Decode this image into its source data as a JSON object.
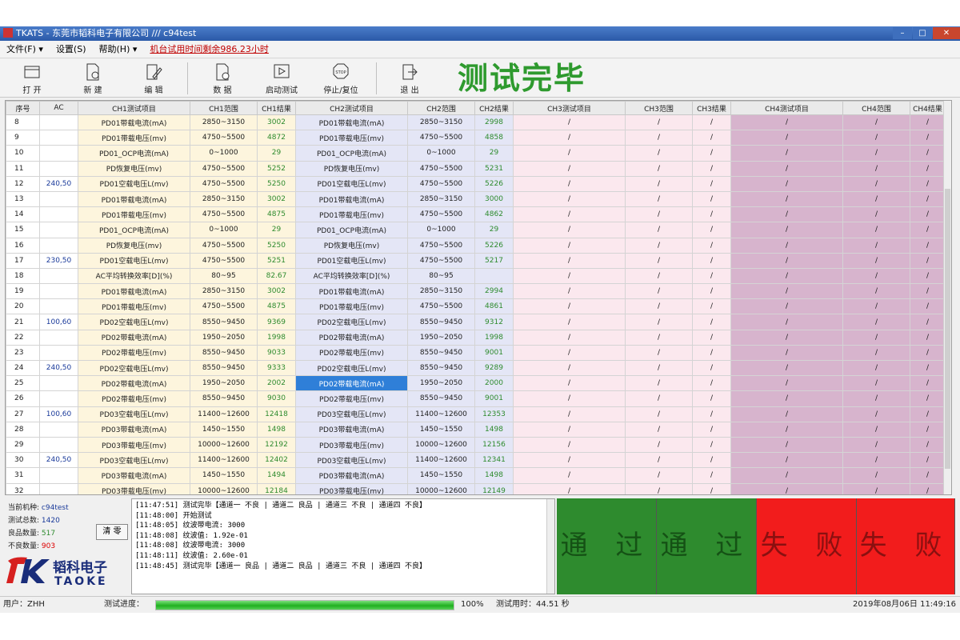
{
  "window": {
    "title": "TKATS - 东莞市韬科电子有限公司 /// c94test",
    "controls": [
      "–",
      "□",
      "✕"
    ]
  },
  "menu": {
    "items": [
      "文件(F) ▾",
      "设置(S)",
      "帮助(H) ▾"
    ],
    "trial_notice": "机台试用时间剩余986.23小时"
  },
  "toolbar": {
    "open": "打 开",
    "new": "新 建",
    "edit": "编 辑",
    "data": "数 据",
    "start": "启动测试",
    "stop": "停止/复位",
    "exit": "退 出",
    "status": "测试完毕"
  },
  "grid": {
    "headers": [
      "序号",
      "AC",
      "CH1测试项目",
      "CH1范围",
      "CH1结果",
      "CH2测试项目",
      "CH2范围",
      "CH2结果",
      "CH3测试项目",
      "CH3范围",
      "CH3结果",
      "CH4测试项目",
      "CH4范围",
      "CH4结果"
    ],
    "rows": [
      [
        "8",
        "",
        "PD01带载电流(mA)",
        "2850~3150",
        "3002",
        "PD01带载电流(mA)",
        "2850~3150",
        "2998"
      ],
      [
        "9",
        "",
        "PD01带载电压(mv)",
        "4750~5500",
        "4872",
        "PD01带载电压(mv)",
        "4750~5500",
        "4858"
      ],
      [
        "10",
        "",
        "PD01_OCP电流(mA)",
        "0~1000",
        "29",
        "PD01_OCP电流(mA)",
        "0~1000",
        "29"
      ],
      [
        "11",
        "",
        "PD恢复电压(mv)",
        "4750~5500",
        "5252",
        "PD恢复电压(mv)",
        "4750~5500",
        "5231"
      ],
      [
        "12",
        "240,50",
        "PD01空载电压L(mv)",
        "4750~5500",
        "5250",
        "PD01空载电压L(mv)",
        "4750~5500",
        "5226"
      ],
      [
        "13",
        "",
        "PD01带载电流(mA)",
        "2850~3150",
        "3002",
        "PD01带载电流(mA)",
        "2850~3150",
        "3000"
      ],
      [
        "14",
        "",
        "PD01带载电压(mv)",
        "4750~5500",
        "4875",
        "PD01带载电压(mv)",
        "4750~5500",
        "4862"
      ],
      [
        "15",
        "",
        "PD01_OCP电流(mA)",
        "0~1000",
        "29",
        "PD01_OCP电流(mA)",
        "0~1000",
        "29"
      ],
      [
        "16",
        "",
        "PD恢复电压(mv)",
        "4750~5500",
        "5250",
        "PD恢复电压(mv)",
        "4750~5500",
        "5226"
      ],
      [
        "17",
        "230,50",
        "PD01空载电压L(mv)",
        "4750~5500",
        "5251",
        "PD01空载电压L(mv)",
        "4750~5500",
        "5217"
      ],
      [
        "18",
        "",
        "AC平均转换效率[D](%)",
        "80~95",
        "82.67",
        "AC平均转换效率[D](%)",
        "80~95",
        ""
      ],
      [
        "19",
        "",
        "PD01带载电流(mA)",
        "2850~3150",
        "3002",
        "PD01带载电流(mA)",
        "2850~3150",
        "2994"
      ],
      [
        "20",
        "",
        "PD01带载电压(mv)",
        "4750~5500",
        "4875",
        "PD01带载电压(mv)",
        "4750~5500",
        "4861"
      ],
      [
        "21",
        "100,60",
        "PD02空载电压L(mv)",
        "8550~9450",
        "9369",
        "PD02空载电压L(mv)",
        "8550~9450",
        "9312"
      ],
      [
        "22",
        "",
        "PD02带载电流(mA)",
        "1950~2050",
        "1998",
        "PD02带载电流(mA)",
        "1950~2050",
        "1998"
      ],
      [
        "23",
        "",
        "PD02带载电压(mv)",
        "8550~9450",
        "9033",
        "PD02带载电压(mv)",
        "8550~9450",
        "9001"
      ],
      [
        "24",
        "240,50",
        "PD02空载电压L(mv)",
        "8550~9450",
        "9333",
        "PD02空载电压L(mv)",
        "8550~9450",
        "9289"
      ],
      [
        "25",
        "",
        "PD02带载电流(mA)",
        "1950~2050",
        "2002",
        "PD02带载电流(mA)",
        "1950~2050",
        "2000"
      ],
      [
        "26",
        "",
        "PD02带载电压(mv)",
        "8550~9450",
        "9030",
        "PD02带载电压(mv)",
        "8550~9450",
        "9001"
      ],
      [
        "27",
        "100,60",
        "PD03空载电压L(mv)",
        "11400~12600",
        "12418",
        "PD03空载电压L(mv)",
        "11400~12600",
        "12353"
      ],
      [
        "28",
        "",
        "PD03带载电流(mA)",
        "1450~1550",
        "1498",
        "PD03带载电流(mA)",
        "1450~1550",
        "1498"
      ],
      [
        "29",
        "",
        "PD03带载电压(mv)",
        "10000~12600",
        "12192",
        "PD03带载电压(mv)",
        "10000~12600",
        "12156"
      ],
      [
        "30",
        "240,50",
        "PD03空载电压L(mv)",
        "11400~12600",
        "12402",
        "PD03空载电压L(mv)",
        "11400~12600",
        "12341"
      ],
      [
        "31",
        "",
        "PD03带载电流(mA)",
        "1450~1550",
        "1494",
        "PD03带载电流(mA)",
        "1450~1550",
        "1498"
      ],
      [
        "32",
        "",
        "PD03带载电压(mv)",
        "10000~12600",
        "12184",
        "PD03带载电压(mv)",
        "10000~12600",
        "12149"
      ]
    ],
    "placeholder": "/",
    "selected": {
      "row": 17,
      "col": 5
    }
  },
  "info": {
    "model_label": "当前机种:",
    "model": "c94test",
    "total_label": "测试总数:",
    "total": "1420",
    "good_label": "良品数量:",
    "good": "517",
    "bad_label": "不良数量:",
    "bad": "903",
    "clear": "清 零"
  },
  "logo": {
    "cn": "韬科电子",
    "en": "TAOKE"
  },
  "log": [
    "[11:47:51] 测试完毕【通道一 不良 | 通道二 良品 | 通道三 不良 | 通道四 不良】",
    "[11:48:00] 开始测试",
    "[11:48:05] 纹波带电流: 3000",
    "[11:48:08] 纹波值: 1.92e-01",
    "[11:48:08] 纹波带电流: 3000",
    "[11:48:11] 纹波值: 2.60e-01",
    "[11:48:45] 测试完毕【通道一 良品 | 通道二 良品 | 通道三 不良 | 通道四 不良】"
  ],
  "results": [
    {
      "label": "通 过",
      "status": "pass"
    },
    {
      "label": "通 过",
      "status": "pass"
    },
    {
      "label": "失 败",
      "status": "fail"
    },
    {
      "label": "失 败",
      "status": "fail"
    }
  ],
  "colors": {
    "pass": "#2e8b2e",
    "fail": "#f21c1c",
    "status_text": "#2e9a2e"
  },
  "statusbar": {
    "user": "用户：ZHH",
    "progress_label": "测试进度：",
    "progress": 100,
    "progress_text": "100%",
    "elapsed": "测试用时：44.51 秒",
    "datetime": "2019年08月06日 11:49:16"
  }
}
